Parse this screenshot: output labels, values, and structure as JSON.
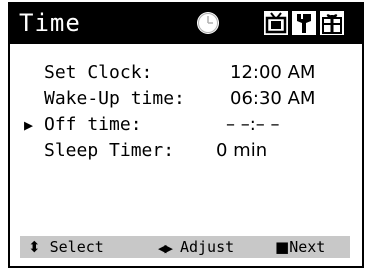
{
  "screen": {
    "title": "Time",
    "tabs": [
      {
        "icon": "clock-icon",
        "active": true
      },
      {
        "icon": "tv-icon",
        "active": false
      },
      {
        "icon": "tools-icon",
        "active": false
      },
      {
        "icon": "gift-icon",
        "active": false
      }
    ]
  },
  "settings": {
    "set_clock": {
      "label": "Set Clock:",
      "value": "12:00 AM"
    },
    "wake_up": {
      "label": "Wake-Up time:",
      "value": "06:30 AM"
    },
    "off_time": {
      "label": "Off time:",
      "value": "– –:– –",
      "selected": true
    },
    "sleep_timer": {
      "label": "Sleep Timer:",
      "value": "0 min"
    }
  },
  "pointer": "▶",
  "hints": {
    "select": {
      "glyph": "⬍",
      "label": "Select"
    },
    "adjust": {
      "glyph": "◀▶",
      "label": "Adjust"
    },
    "next": {
      "glyph": "■",
      "label": "Next"
    }
  },
  "colors": {
    "titlebar": "#000000",
    "title_text": "#ffffff",
    "hintbar": "#c8c8c8"
  }
}
